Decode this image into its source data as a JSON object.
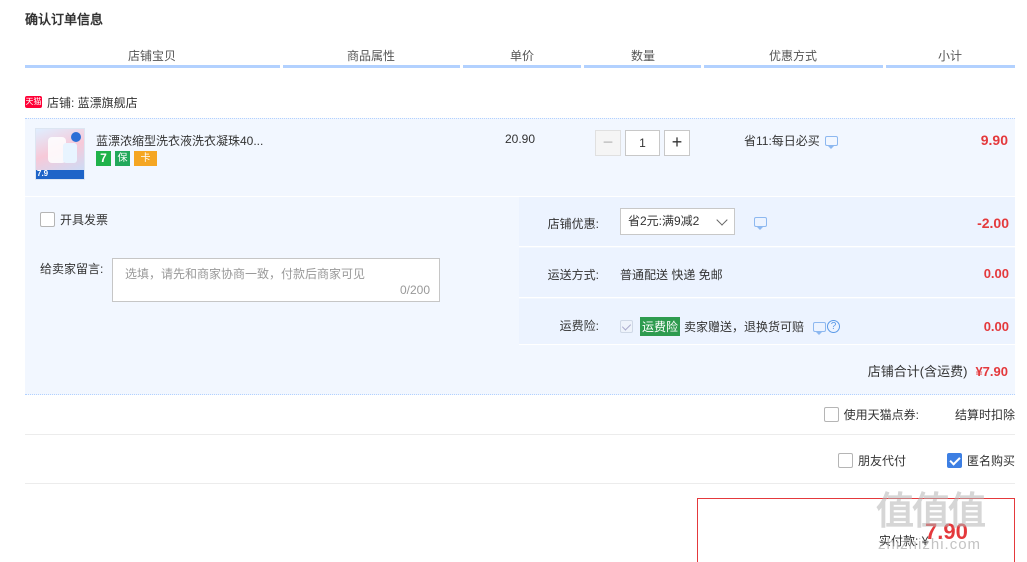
{
  "page_title": "确认订单信息",
  "columns": [
    "店铺宝贝",
    "商品属性",
    "单价",
    "数量",
    "优惠方式",
    "小计"
  ],
  "shop": {
    "platform_badge": "天猫",
    "label": "店铺: 蓝漂旗舰店"
  },
  "item": {
    "title": "蓝漂浓缩型洗衣液洗衣凝珠40...",
    "thumb_price": "7.9",
    "unit_price": "20.90",
    "quantity": "1",
    "promo": "省11:每日必买",
    "subtotal": "9.90",
    "badges": [
      "7",
      "保",
      "卡"
    ]
  },
  "order": {
    "invoice_label": "开具发票",
    "message_label": "给卖家留言:",
    "message_placeholder": "选填，请先和商家协商一致，付款后商家可见",
    "message_count": "0/200",
    "shop_discount_label": "店铺优惠:",
    "shop_discount_value": "省2元:满9减2",
    "shop_discount_amount": "-2.00",
    "shipping_label": "运送方式:",
    "shipping_value": "普通配送 快递 免邮",
    "shipping_amount": "0.00",
    "insurance_label": "运费险:",
    "insurance_tag": "运费险",
    "insurance_text": "卖家赠送，退换货可赔",
    "insurance_amount": "0.00",
    "shop_total_label": "店铺合计(含运费)",
    "shop_total_amount": "¥7.90"
  },
  "extras": {
    "coupon_label": "使用天猫点券:",
    "coupon_note": "结算时扣除",
    "friend_pay_label": "朋友代付",
    "anonymous_label": "匿名购买"
  },
  "payment": {
    "label": "实付款:",
    "currency": "¥",
    "amount": "7.90"
  },
  "watermark": {
    "main": "值值值",
    "sub": "zhizhizhi.com"
  },
  "colors": {
    "accent_red": "#e4393c",
    "header_line": "#b2d1ff",
    "panel_bg": "#f2f7ff",
    "checkbox_blue": "#3d7fe3"
  }
}
